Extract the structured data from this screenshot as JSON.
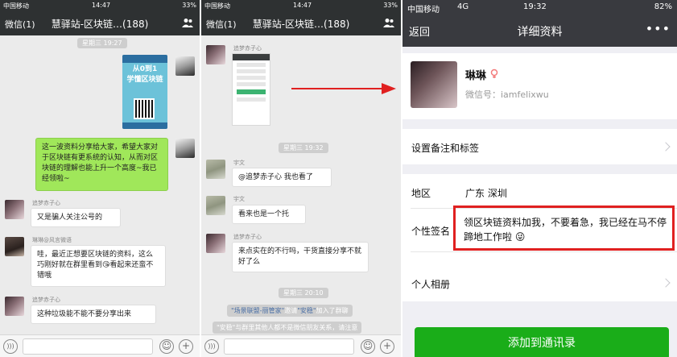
{
  "colors": {
    "wechat_green": "#1aad19",
    "bubble_green": "#a0e75a",
    "highlight_red": "#e02020",
    "nav_dark": "#2e3132"
  },
  "panel1": {
    "status": {
      "carrier": "中国移动",
      "time": "14:47",
      "battery": "33%"
    },
    "nav": {
      "back": "微信(1)",
      "title": "慧驿站-区块链…(188)"
    },
    "time1": "星期三 19:27",
    "poster": {
      "line1": "从0到1",
      "line2": "学懂区块链"
    },
    "msg_green": "这一波资料分享给大家，希望大家对于区块链有更系统的认知，从而对区块链的理解也能上升一个高度~我已经领啦~",
    "m1": {
      "sender": "追梦赤子心",
      "text": "又是骗人关注公号的"
    },
    "m2": {
      "sender": "琳琳@风言微语",
      "text": "哇，最近正想要区块链的资料，这么巧刚好就在群里看到😘看起来还蛮不错哦"
    },
    "m3": {
      "sender": "追梦赤子心",
      "text": "这种垃圾能不能不要分享出来"
    }
  },
  "panel2": {
    "status": {
      "carrier": "中国移动",
      "time": "14:47",
      "battery": "33%"
    },
    "nav": {
      "back": "微信(1)",
      "title": "慧驿站-区块链…(188)"
    },
    "m1": {
      "sender": "追梦赤子心"
    },
    "time2": "星期三 19:32",
    "m2": {
      "sender": "宇文",
      "text": "@追梦赤子心 我也看了"
    },
    "m3": {
      "sender": "宇文",
      "text": "看来也是一个托"
    },
    "m4": {
      "sender": "追梦赤子心",
      "text": "来点实在的不行吗，干货直接分享不就好了么"
    },
    "time3": "星期三 20:10",
    "sys1": {
      "a": "\"场景联盟-丽管家\"",
      "b": "邀请",
      "c": "\"安稳\"",
      "d": "加入了群聊"
    },
    "sys2": "\"安稳\"与群里其他人都不是微信朋友关系，请注意"
  },
  "panel3": {
    "status": {
      "carrier": "中国移动",
      "network": "4G",
      "time": "19:32",
      "battery": "82%"
    },
    "nav": {
      "back": "返回",
      "title": "详细资料",
      "more": "•••"
    },
    "profile": {
      "name": "琳琳",
      "wechat_id": "微信号：iamfelixwu"
    },
    "remark_label": "设置备注和标签",
    "region_label": "地区",
    "region_value": "广东  深圳",
    "signature_label": "个性签名",
    "signature_value": "领区块链资料加我，不要着急，我已经在马不停蹄地工作啦 😜",
    "album_label": "个人相册",
    "add_button": "添加到通讯录"
  }
}
